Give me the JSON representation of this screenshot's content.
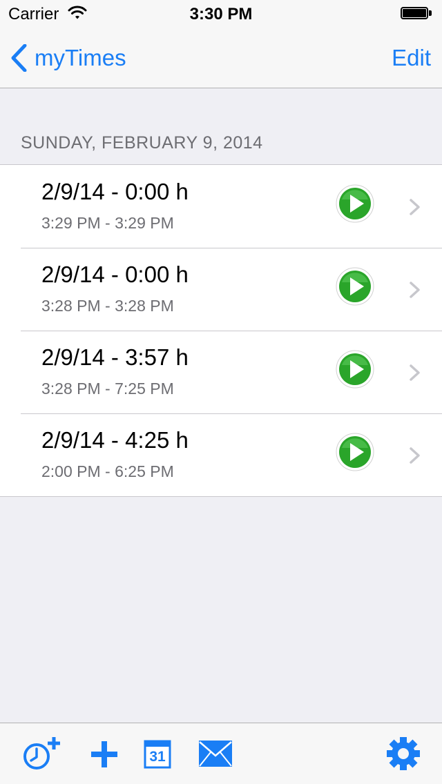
{
  "status_bar": {
    "carrier": "Carrier",
    "time": "3:30 PM"
  },
  "nav": {
    "back_label": "myTimes",
    "edit_label": "Edit"
  },
  "section": {
    "header": "SUNDAY, FEBRUARY 9, 2014"
  },
  "rows": [
    {
      "title": "2/9/14 - 0:00 h",
      "subtitle": "3:29 PM - 3:29 PM"
    },
    {
      "title": "2/9/14 - 0:00 h",
      "subtitle": "3:28 PM - 3:28 PM"
    },
    {
      "title": "2/9/14 - 3:57 h",
      "subtitle": "3:28 PM - 7:25 PM"
    },
    {
      "title": "2/9/14 - 4:25 h",
      "subtitle": "2:00 PM - 6:25 PM"
    }
  ],
  "toolbar": {
    "calendar_day": "31",
    "items": [
      "add-timer-icon",
      "plus-icon",
      "calendar-icon",
      "mail-icon",
      "gear-icon"
    ]
  },
  "colors": {
    "accent": "#1a7ef5",
    "play_green": "#2aa52a",
    "background": "#efeff4"
  }
}
